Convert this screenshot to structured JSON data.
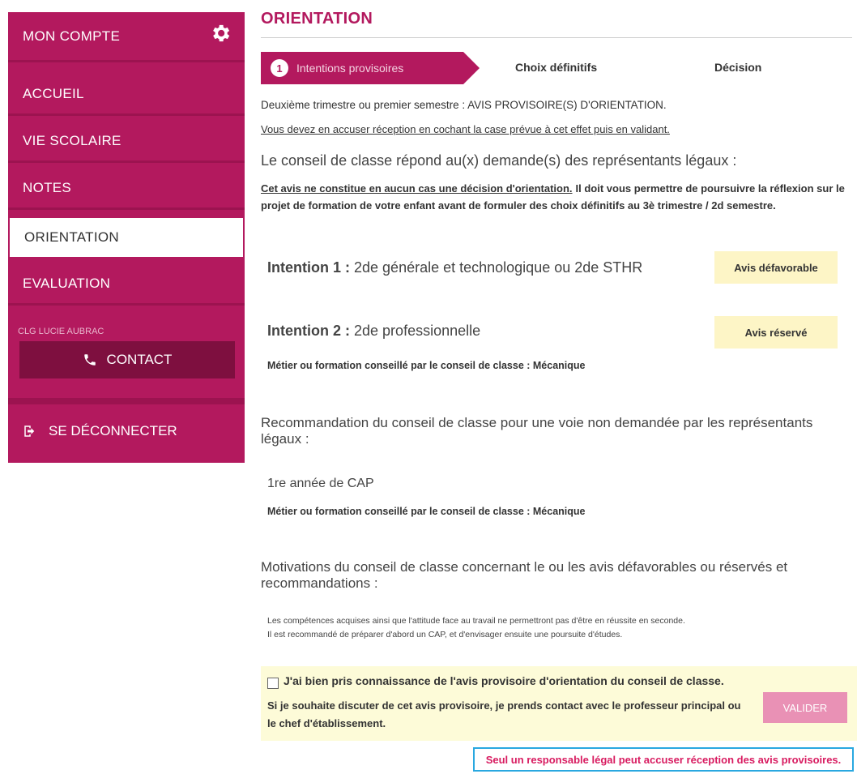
{
  "sidebar": {
    "account": "MON COMPTE",
    "items": [
      {
        "label": "ACCUEIL"
      },
      {
        "label": "VIE SCOLAIRE"
      },
      {
        "label": "NOTES"
      },
      {
        "label": "ORIENTATION"
      },
      {
        "label": "EVALUATION"
      }
    ],
    "school": "CLG LUCIE AUBRAC",
    "contact": "CONTACT",
    "logout": "SE DÉCONNECTER",
    "brand_color": "#b3195e"
  },
  "page": {
    "title": "ORIENTATION",
    "steps": [
      {
        "number": "1",
        "label": "Intentions provisoires",
        "active": true
      },
      {
        "label": "Choix définitifs"
      },
      {
        "label": "Décision"
      }
    ],
    "subtitle": "Deuxième trimestre ou premier semestre : AVIS PROVISOIRE(S) D'ORIENTATION.",
    "ack_instruction": "Vous devez en accuser réception en cochant la case prévue à cet effet puis en validant.",
    "section_heading": "Le conseil de classe répond au(x) demande(s) des représentants légaux :",
    "warning_underlined": "Cet avis ne constitue en aucun cas une décision d'orientation.",
    "warning_rest": "Il doit vous permettre de poursuivre la réflexion sur le projet de formation de votre enfant avant de formuler des choix définitifs au 3è trimestre / 2d semestre.",
    "intentions": [
      {
        "prefix": "Intention 1 :",
        "text": "2de générale et technologique ou 2de STHR",
        "avis": "Avis défavorable"
      },
      {
        "prefix": "Intention 2 :",
        "text": "2de professionnelle",
        "avis": "Avis réservé",
        "metier": "Métier ou formation conseillé par le conseil de classe : Mécanique"
      }
    ],
    "recommendation": {
      "heading_line1": "Recommandation du conseil de classe pour une voie non demandée par les représentants",
      "heading_line2": "légaux :",
      "value": "1re année de CAP",
      "metier": "Métier ou formation conseillé par le conseil de classe : Mécanique"
    },
    "motivations": {
      "heading_line1": "Motivations du conseil de classe concernant le ou les avis défavorables ou réservés et",
      "heading_line2": "recommandations :",
      "line1": "Les compétences acquises ainsi que l'attitude face au travail ne permettront pas d'être en réussite en seconde.",
      "line2": "Il est recommandé de préparer d'abord un CAP, et d'envisager ensuite une poursuite d'études."
    },
    "acknowledge": {
      "title": "J'ai bien pris connaissance de l'avis provisoire d'orientation du conseil de classe.",
      "desc_line1": "Si je souhaite discuter de cet avis provisoire, je prends contact avec le professeur principal ou",
      "desc_line2": "le chef d'établissement.",
      "button": "VALIDER"
    },
    "note": "Seul un responsable légal peut accuser réception des avis provisoires."
  }
}
